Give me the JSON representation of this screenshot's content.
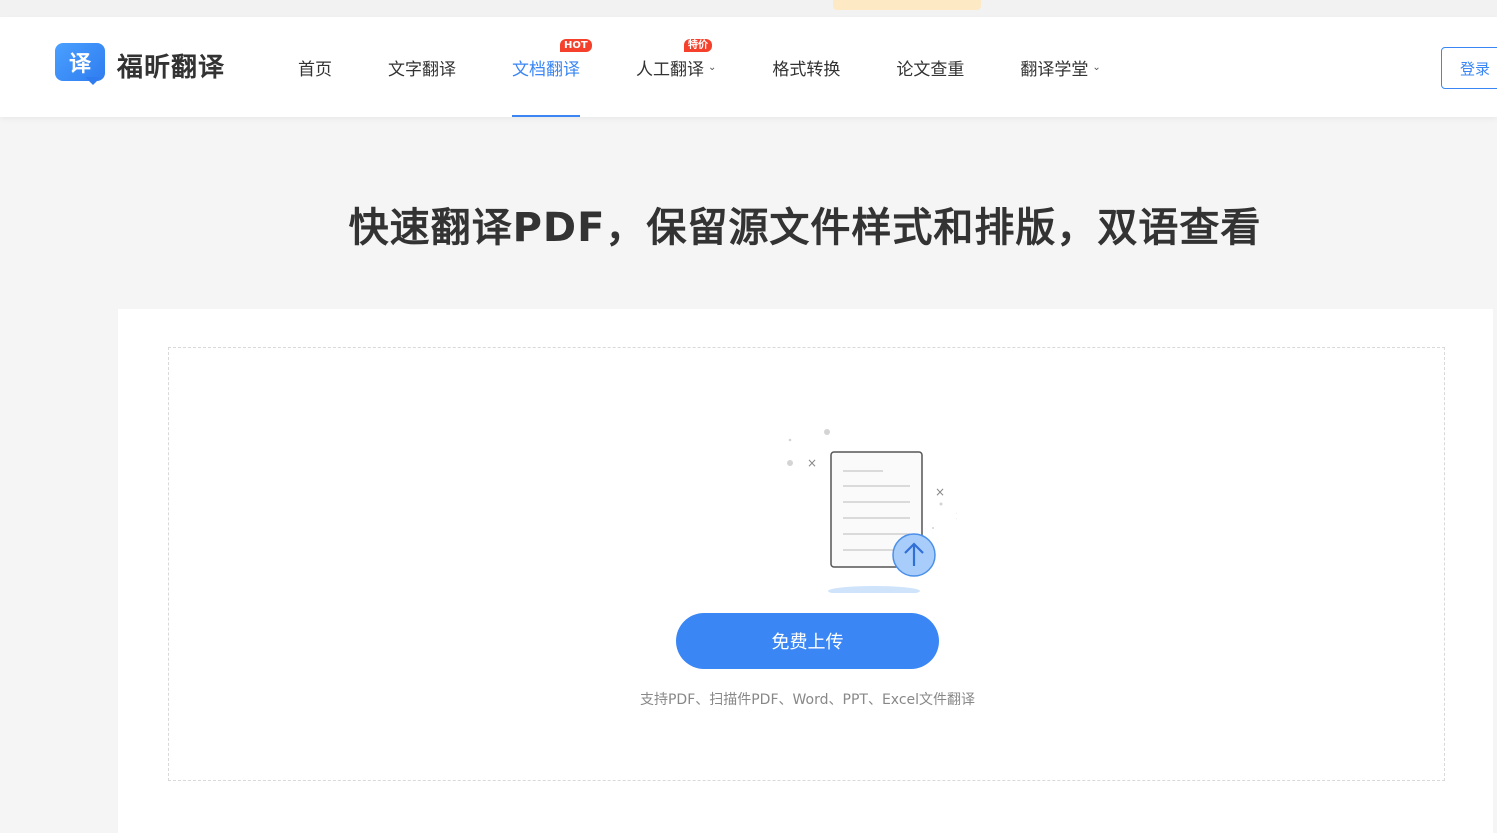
{
  "brand": {
    "logo_char": "译",
    "name": "福昕翻译"
  },
  "nav": {
    "items": [
      {
        "label": "首页"
      },
      {
        "label": "文字翻译"
      },
      {
        "label": "文档翻译",
        "badge": "HOT"
      },
      {
        "label": "人工翻译",
        "badge": "特价"
      },
      {
        "label": "格式转换"
      },
      {
        "label": "论文查重"
      },
      {
        "label": "翻译学堂"
      }
    ],
    "active_index": 2
  },
  "login_label": "登录",
  "headline": "快速翻译PDF，保留源文件样式和排版，双语查看",
  "upload": {
    "button_label": "免费上传",
    "support_text": "支持PDF、扫描件PDF、Word、PPT、Excel文件翻译"
  },
  "colors": {
    "accent": "#3a86f5",
    "badge": "#f5402c",
    "background": "#f5f5f5"
  },
  "icons": [
    "upload-arrow-icon",
    "document-icon",
    "chevron-down-icon"
  ]
}
